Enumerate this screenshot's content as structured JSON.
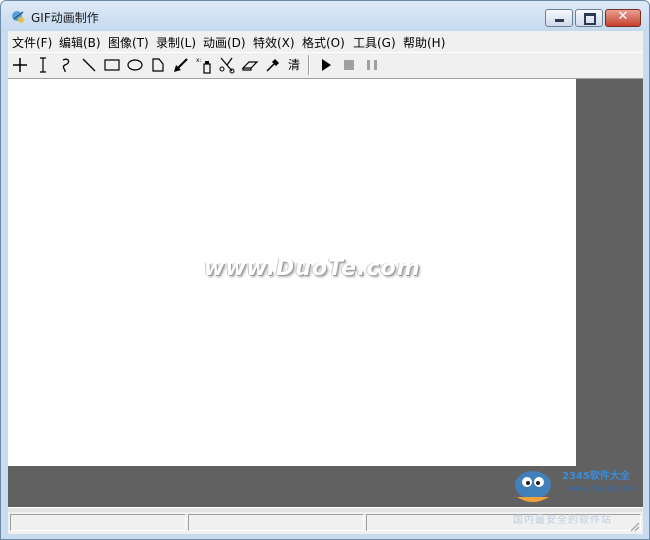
{
  "window": {
    "title": "GIF动画制作"
  },
  "menu": [
    "文件(F)",
    "编辑(B)",
    "图像(T)",
    "录制(L)",
    "动画(D)",
    "特效(X)",
    "格式(O)",
    "工具(G)",
    "帮助(H)"
  ],
  "toolbar": {
    "tools": [
      "crosshair-icon",
      "text-cursor-icon",
      "freehand-icon",
      "line-icon",
      "rectangle-icon",
      "ellipse-icon",
      "polygon-icon",
      "fill-arrow-icon",
      "spray-icon",
      "scissors-icon",
      "eraser-icon",
      "eyedropper-icon",
      "clear-label",
      "play-icon",
      "stop-icon",
      "pause-icon"
    ],
    "clear_label": "清"
  },
  "canvas": {
    "watermark": "www.DuoTe.com"
  },
  "logo": {
    "brand": "2345软件大全",
    "url": "www.DuoTe.com",
    "slogan": "国内最安全的软件站"
  },
  "colors": {
    "workspace": "#616161",
    "canvas": "#ffffff",
    "titlebar": "#c9dcef",
    "close": "#c7412c"
  }
}
